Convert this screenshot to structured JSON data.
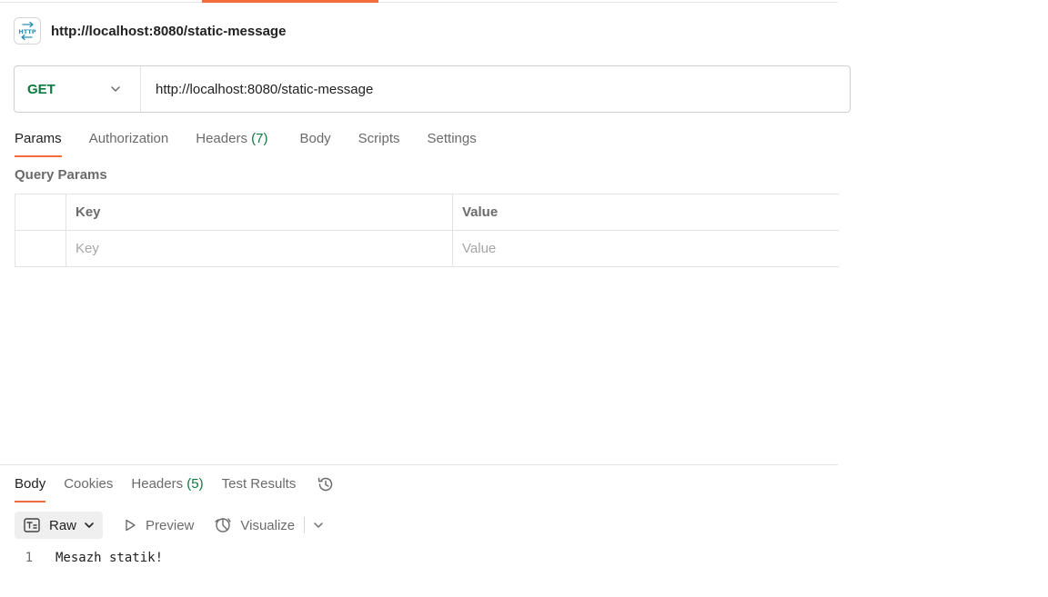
{
  "request": {
    "title": "http://localhost:8080/static-message",
    "icon": "http-request-icon",
    "method": "GET",
    "url": "http://localhost:8080/static-message"
  },
  "request_tabs": [
    {
      "label": "Params",
      "count": "",
      "active": true
    },
    {
      "label": "Authorization",
      "count": "",
      "active": false
    },
    {
      "label": "Headers",
      "count": "(7)",
      "active": false
    },
    {
      "label": "Body",
      "count": "",
      "active": false
    },
    {
      "label": "Scripts",
      "count": "",
      "active": false
    },
    {
      "label": "Settings",
      "count": "",
      "active": false
    }
  ],
  "query_params": {
    "title": "Query Params",
    "columns": [
      "Key",
      "Value"
    ],
    "placeholders": {
      "key": "Key",
      "value": "Value"
    }
  },
  "response_tabs": [
    {
      "label": "Body",
      "count": "",
      "active": true
    },
    {
      "label": "Cookies",
      "count": "",
      "active": false
    },
    {
      "label": "Headers",
      "count": "(5)",
      "active": false
    },
    {
      "label": "Test Results",
      "count": "",
      "active": false
    }
  ],
  "response_toolbar": {
    "format": "Raw",
    "preview": "Preview",
    "visualize": "Visualize"
  },
  "response_body": {
    "lines": [
      {
        "number": "1",
        "text": "Mesazh statik!"
      }
    ]
  },
  "colors": {
    "accent": "#f26b3a",
    "method_get": "#0b7a3f"
  }
}
